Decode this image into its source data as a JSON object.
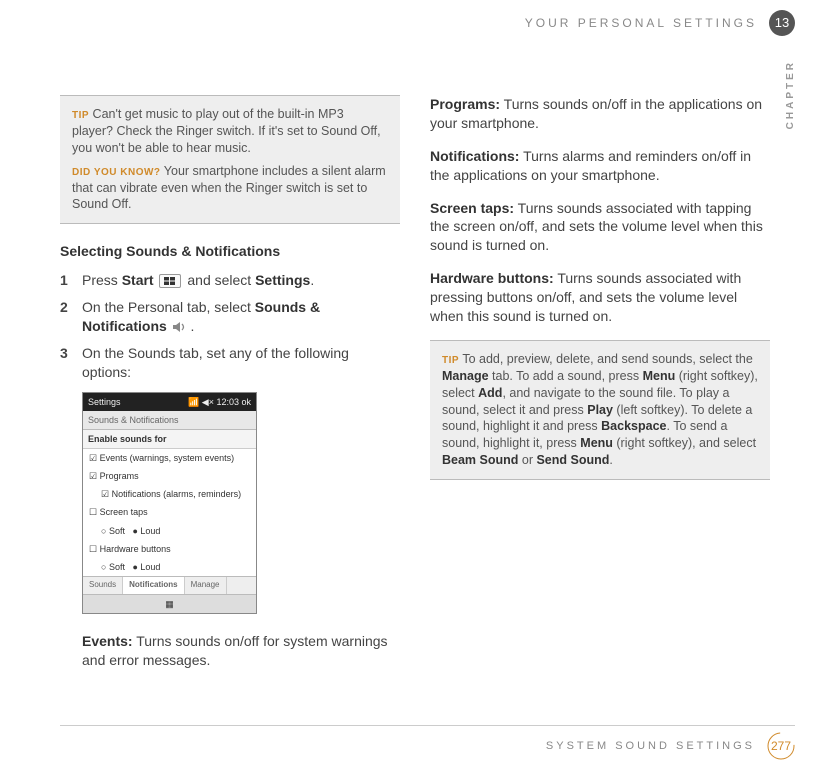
{
  "header": {
    "title": "YOUR PERSONAL SETTINGS",
    "chapter_number": "13",
    "side_label": "CHAPTER"
  },
  "left": {
    "tip1": {
      "label": "TIP",
      "text": "Can't get music to play out of the built-in MP3 player? Check the Ringer switch. If it's set to Sound Off, you won't be able to hear music."
    },
    "dyk": {
      "label": "DID YOU KNOW?",
      "text": "Your smartphone includes a silent alarm that can vibrate even when the Ringer switch is set to Sound Off."
    },
    "heading": "Selecting Sounds & Notifications",
    "steps": {
      "s1": {
        "num": "1",
        "a": "Press ",
        "b": "Start",
        "c": " and select ",
        "d": "Settings",
        "e": "."
      },
      "s2": {
        "num": "2",
        "a": "On the Personal tab, select ",
        "b": "Sounds & Notifications",
        "c": " ."
      },
      "s3": {
        "num": "3",
        "a": "On the Sounds tab, set any of the following options:"
      }
    },
    "mock": {
      "top_left": "Settings",
      "top_right": "📶 ◀× 12:03  ok",
      "title": "Sounds & Notifications",
      "subhead": "Enable sounds for",
      "r1": "Events (warnings, system events)",
      "r2": "Programs",
      "r3": "Notifications (alarms, reminders)",
      "r4": "Screen taps",
      "r5a": "Soft",
      "r5b": "Loud",
      "r6": "Hardware buttons",
      "r7a": "Soft",
      "r7b": "Loud",
      "tab1": "Sounds",
      "tab2": "Notifications",
      "tab3": "Manage",
      "btn": "▦"
    },
    "events": {
      "label": "Events:",
      "text": " Turns sounds on/off for system warnings and error messages."
    }
  },
  "right": {
    "programs": {
      "label": "Programs:",
      "text": " Turns sounds on/off in the applications on your smartphone."
    },
    "notifications": {
      "label": "Notifications:",
      "text": " Turns alarms and reminders on/off in the applications on your smartphone."
    },
    "screentaps": {
      "label": "Screen taps:",
      "text": " Turns sounds associated with tapping the screen on/off, and sets the volume level when this sound is turned on."
    },
    "hardware": {
      "label": "Hardware buttons:",
      "text": " Turns sounds associated with pressing buttons on/off, and sets the volume level when this sound is turned on."
    },
    "tip2": {
      "label": "TIP",
      "a": "To add, preview, delete, and send sounds, select the ",
      "b": "Manage",
      "c": " tab. To add a sound, press ",
      "d": "Menu",
      "e": " (right softkey), select ",
      "f": "Add",
      "g": ", and navigate to the sound file. To play a sound, select it and press ",
      "h": "Play",
      "i": " (left softkey). To delete a sound, highlight it and press ",
      "j": "Backspace",
      "k": ". To send a sound, highlight it, press ",
      "l": "Menu",
      "m": " (right softkey), and select ",
      "n": "Beam Sound",
      "o": " or ",
      "p": "Send Sound",
      "q": "."
    }
  },
  "footer": {
    "title": "SYSTEM SOUND SETTINGS",
    "page": "277"
  }
}
